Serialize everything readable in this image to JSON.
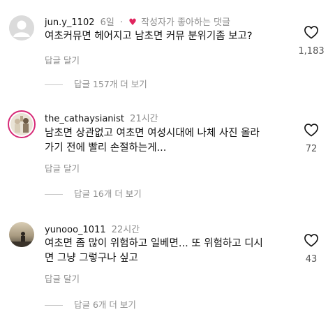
{
  "comments": [
    {
      "username": "jun.y_1102",
      "time": "6일",
      "liked_by_author": "작성자가 좋아하는 댓글",
      "separator": "·",
      "text_lines": [
        "여초커뮤면 헤어지고 남초면 커뮤 분위기좀 보고?"
      ],
      "reply_label": "답글 달기",
      "view_replies": "답글 157개 더 보기",
      "like_count": "1,183"
    },
    {
      "username": "the_cathaysianist",
      "time": "21시간",
      "text_lines": [
        "남초면 상관없고 여초면 여성시대에 나체 사진 올라",
        "가기 전에 빨리 손절하는게..."
      ],
      "reply_label": "답글 달기",
      "view_replies": "답글 16개 더 보기",
      "like_count": "72"
    },
    {
      "username": "yunooo_1011",
      "time": "22시간",
      "text_lines": [
        "여초면 좀 많이 위험하고 일베면... 또 위험하고 디시",
        "면 그냥 그렇구나 싶고"
      ],
      "reply_label": "답글 달기",
      "view_replies": "답글 6개 더 보기",
      "like_count": "43"
    }
  ],
  "colors": {
    "text": "#111111",
    "secondary": "#8e8e8e",
    "liked_heart": "#e0245e",
    "story_ring": "#d62976"
  },
  "icons": {
    "like": "heart-outline-icon",
    "author_like": "heart-filled-icon"
  }
}
